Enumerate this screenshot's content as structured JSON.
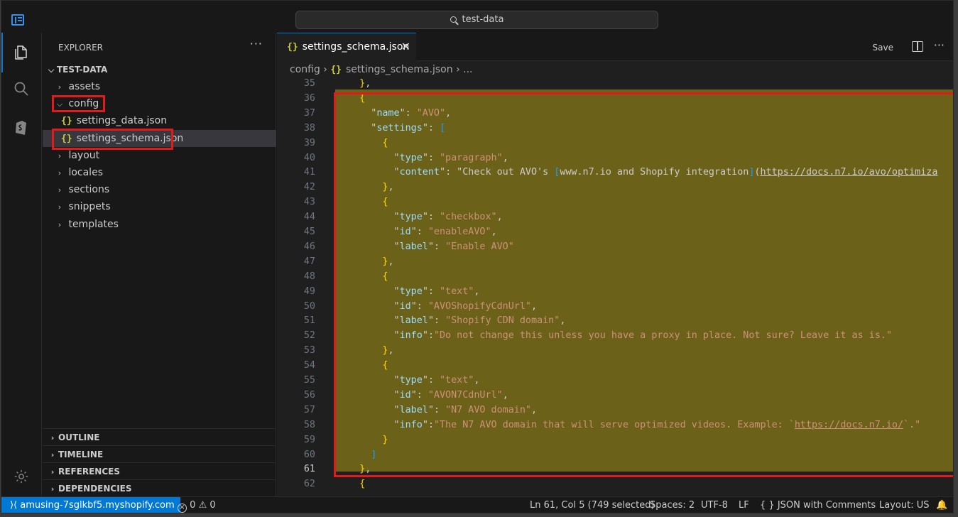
{
  "titlebar": {
    "search_text": "test-data",
    "app_icon": "vscode-layout-icon"
  },
  "activity_bar": {
    "icons": [
      "explorer-icon",
      "search-icon",
      "shopify-icon",
      "gear-icon"
    ]
  },
  "sidebar": {
    "title": "EXPLORER",
    "more": "···",
    "root": "TEST-DATA",
    "items": [
      {
        "label": "assets",
        "type": "folder",
        "expanded": false
      },
      {
        "label": "config",
        "type": "folder",
        "expanded": true
      },
      {
        "label": "settings_data.json",
        "type": "file"
      },
      {
        "label": "settings_schema.json",
        "type": "file",
        "selected": true
      },
      {
        "label": "layout",
        "type": "folder",
        "expanded": false
      },
      {
        "label": "locales",
        "type": "folder",
        "expanded": false
      },
      {
        "label": "sections",
        "type": "folder",
        "expanded": false
      },
      {
        "label": "snippets",
        "type": "folder",
        "expanded": false
      },
      {
        "label": "templates",
        "type": "folder",
        "expanded": false
      }
    ],
    "sections": [
      "OUTLINE",
      "TIMELINE",
      "REFERENCES",
      "DEPENDENCIES"
    ]
  },
  "editor": {
    "tab_label": "settings_schema.json",
    "tab_icon": "{}",
    "save_label": "Save",
    "breadcrumb": {
      "folder": "config",
      "file": "settings_schema.json",
      "rest": "..."
    },
    "current_line": "61",
    "lines": [
      {
        "n": "35",
        "t": "  },"
      },
      {
        "n": "36",
        "t": "  {"
      },
      {
        "n": "37",
        "t": "    \"name\": \"AVO\","
      },
      {
        "n": "38",
        "t": "    \"settings\": ["
      },
      {
        "n": "39",
        "t": "      {"
      },
      {
        "n": "40",
        "t": "        \"type\": \"paragraph\","
      },
      {
        "n": "41",
        "t": "        \"content\": \"Check out AVO's [www.n7.io and Shopify integration](https://docs.n7.io/avo/optimiza"
      },
      {
        "n": "42",
        "t": "      },"
      },
      {
        "n": "43",
        "t": "      {"
      },
      {
        "n": "44",
        "t": "        \"type\": \"checkbox\","
      },
      {
        "n": "45",
        "t": "        \"id\": \"enableAVO\","
      },
      {
        "n": "46",
        "t": "        \"label\": \"Enable AVO\""
      },
      {
        "n": "47",
        "t": "      },"
      },
      {
        "n": "48",
        "t": "      {"
      },
      {
        "n": "49",
        "t": "        \"type\": \"text\","
      },
      {
        "n": "50",
        "t": "        \"id\": \"AVOShopifyCdnUrl\","
      },
      {
        "n": "51",
        "t": "        \"label\": \"Shopify CDN domain\","
      },
      {
        "n": "52",
        "t": "        \"info\":\"Do not change this unless you have a proxy in place. Not sure? Leave it as is.\""
      },
      {
        "n": "53",
        "t": "      },"
      },
      {
        "n": "54",
        "t": "      {"
      },
      {
        "n": "55",
        "t": "        \"type\": \"text\","
      },
      {
        "n": "56",
        "t": "        \"id\": \"AVON7CdnUrl\","
      },
      {
        "n": "57",
        "t": "        \"label\": \"N7 AVO domain\","
      },
      {
        "n": "58",
        "t": "        \"info\":\"The N7 AVO domain that will serve optimized videos. Example: `https://docs.n7.io/`.\""
      },
      {
        "n": "59",
        "t": "      }"
      },
      {
        "n": "60",
        "t": "    ]"
      },
      {
        "n": "61",
        "t": "  },"
      },
      {
        "n": "62",
        "t": "  {"
      }
    ]
  },
  "statusbar": {
    "remote": "amusing-7sglkbf5.myshopify.com",
    "errors": "0",
    "warnings": "0",
    "position": "Ln 61, Col 5 (749 selected)",
    "spaces": "Spaces: 2",
    "encoding": "UTF-8",
    "eol": "LF",
    "language": "JSON with Comments",
    "layout": "Layout: US"
  },
  "colors": {
    "accent": "#0078d4",
    "selection": "#6b6118",
    "highlight_border": "#e11b1b"
  }
}
